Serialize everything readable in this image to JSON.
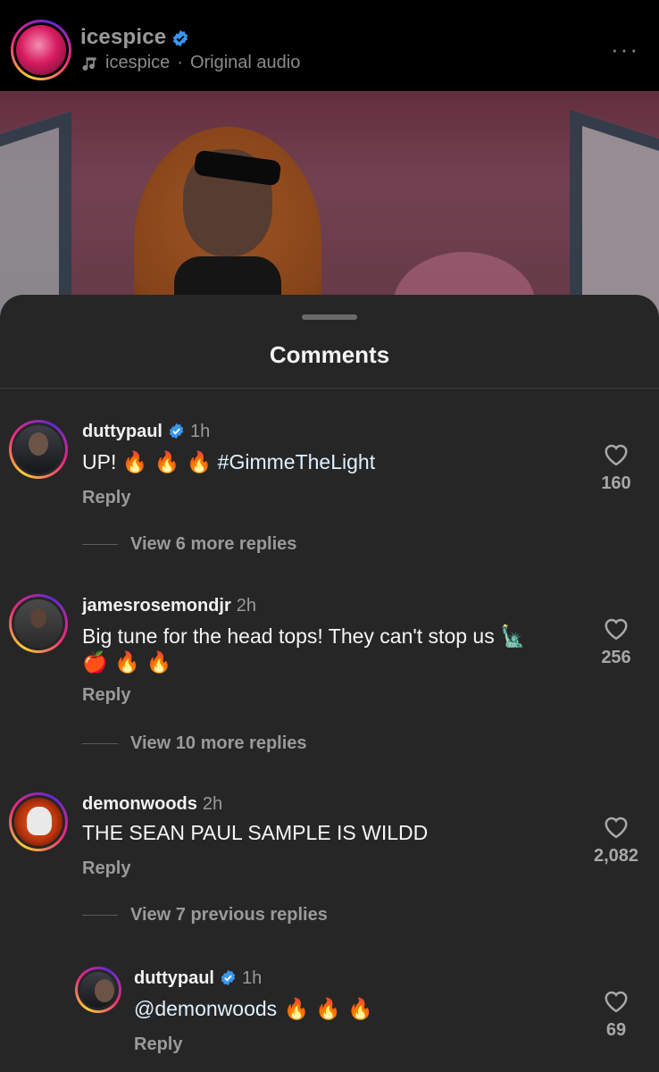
{
  "header": {
    "username": "icespice",
    "audio_owner": "icespice",
    "audio_sep": "·",
    "audio_label": "Original audio",
    "more": "···"
  },
  "sheet": {
    "title": "Comments"
  },
  "comments": [
    {
      "username": "duttypaul",
      "verified": true,
      "time": "1h",
      "text_prefix": "UP! ",
      "emojis": "🔥 🔥 🔥",
      "hashtag": " #GimmeTheLight",
      "reply": "Reply",
      "likes": "160",
      "view_replies": "View 6 more replies"
    },
    {
      "username": "jamesrosemondjr",
      "verified": false,
      "time": "2h",
      "text_line1": "Big tune for the head tops! They can't stop us 🗽",
      "text_line2": "🍎 🔥 🔥",
      "reply": "Reply",
      "likes": "256",
      "view_replies": "View 10 more replies"
    },
    {
      "username": "demonwoods",
      "verified": false,
      "time": "2h",
      "text": "THE SEAN PAUL SAMPLE IS WILDD",
      "reply": "Reply",
      "likes": "2,082",
      "view_replies": "View 7 previous replies"
    },
    {
      "username": "duttypaul",
      "verified": true,
      "time": "1h",
      "mention": "@demonwoods",
      "emojis": " 🔥 🔥 🔥",
      "reply": "Reply",
      "likes": "69"
    }
  ],
  "colors": {
    "background": "#000000",
    "sheet": "#262626",
    "verified": "#3897f0",
    "muted": "#9a9a9a"
  }
}
